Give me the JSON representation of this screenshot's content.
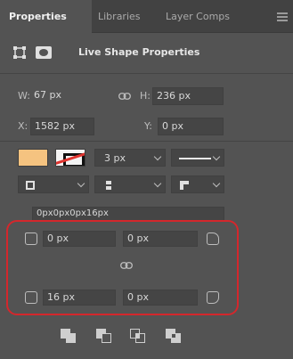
{
  "tabs": {
    "properties": "Properties",
    "libraries": "Libraries",
    "layer_comps": "Layer Comps"
  },
  "header": {
    "title": "Live Shape Properties"
  },
  "transform": {
    "w_label": "W:",
    "w_value": "67 px",
    "h_label": "H:",
    "h_value": "236 px",
    "x_label": "X:",
    "x_value": "1582 px",
    "y_label": "Y:",
    "y_value": "0 px"
  },
  "appearance": {
    "fill_color": "#f5c380",
    "stroke_width": "3 px"
  },
  "corners": {
    "summary": "0px0px0px16px",
    "top_left": "0 px",
    "top_right": "0 px",
    "bottom_left": "16 px",
    "bottom_right": "0 px"
  },
  "colors": {
    "panel_bg": "#535353",
    "tab_bg": "#424242",
    "highlight": "#d4272c"
  },
  "icons": {
    "shape_bounds": "bounding-box-icon",
    "mask": "mask-icon",
    "link": "link-icon",
    "menu": "panel-menu-icon"
  }
}
